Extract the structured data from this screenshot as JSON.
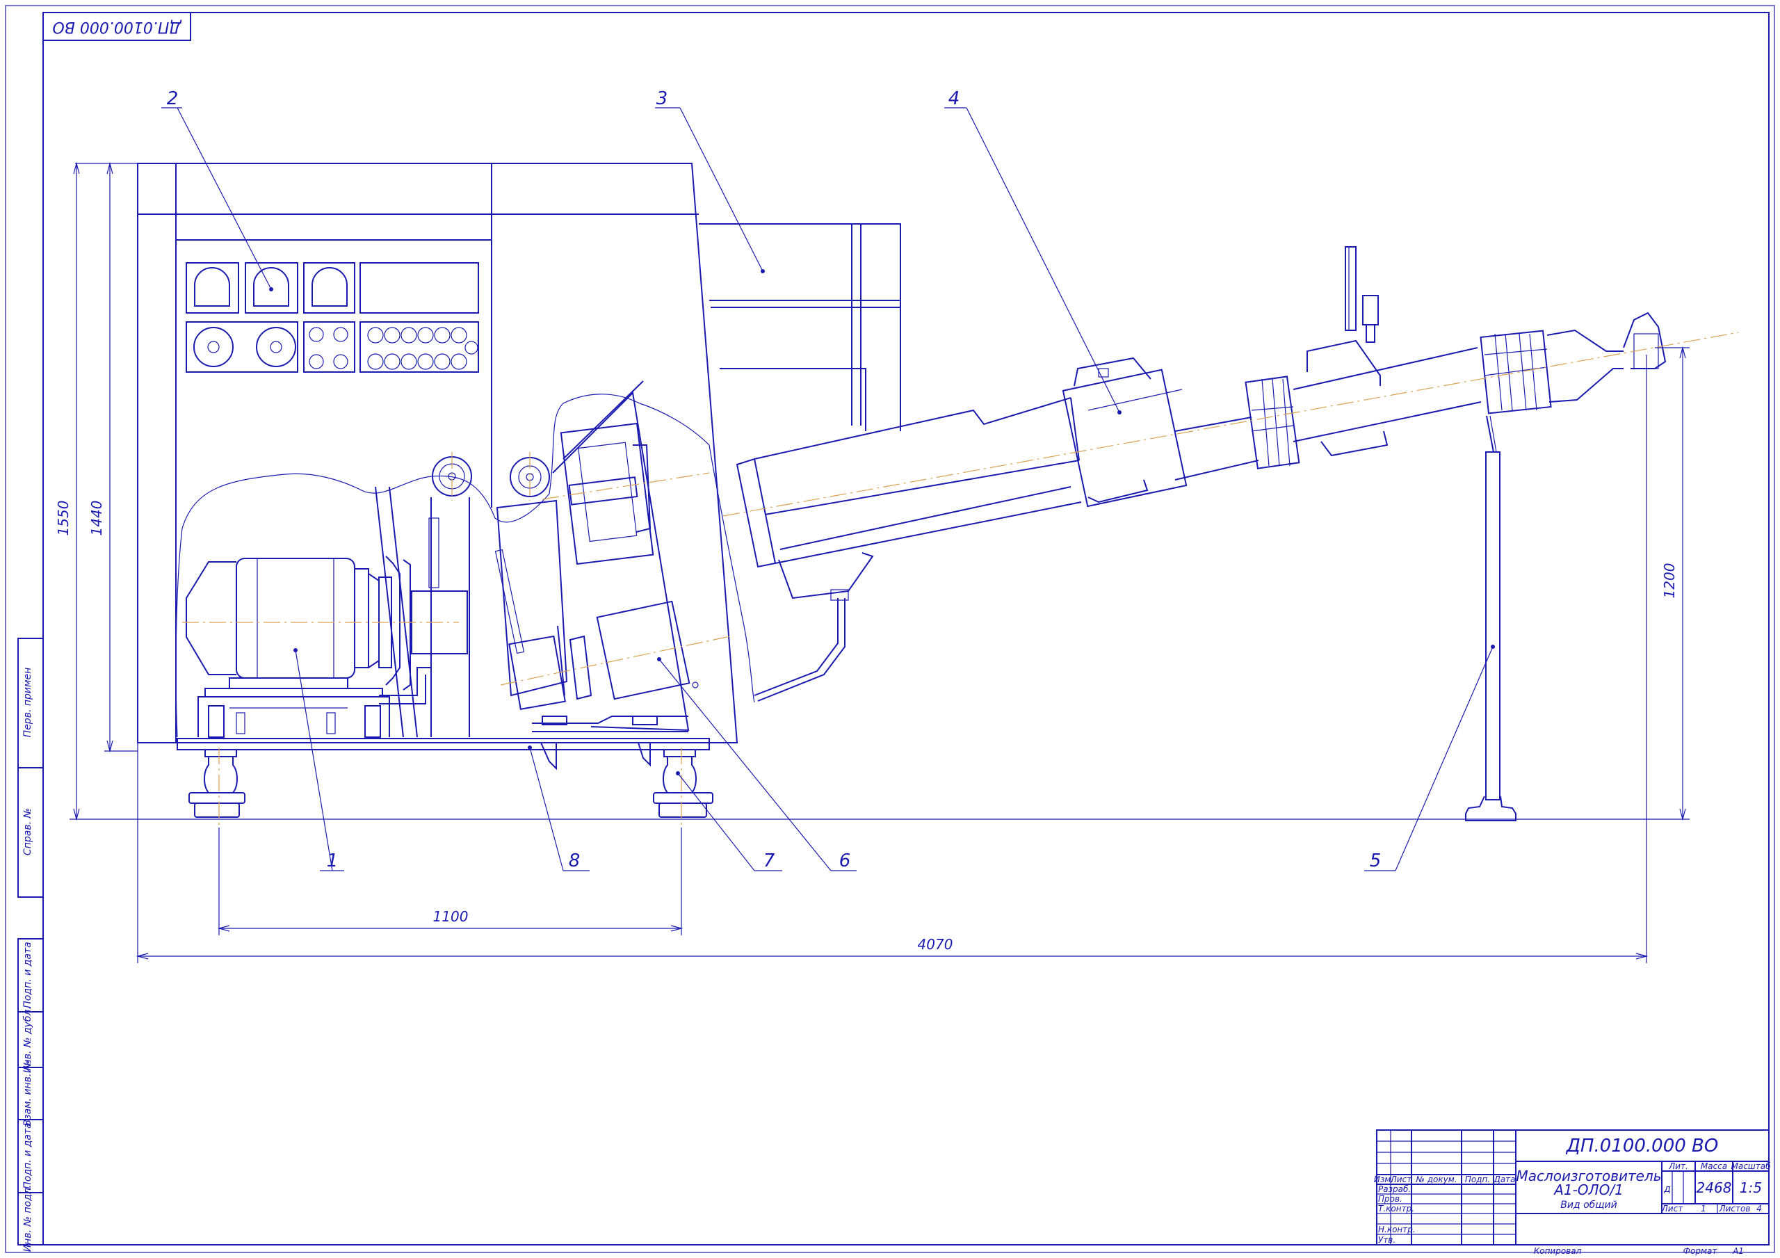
{
  "drawing": {
    "corner_code": "ДП.0100.000 ВО",
    "dimensions": {
      "height_overall": "1550",
      "height_body": "1440",
      "height_support": "1200",
      "span_feet": "1100",
      "length_overall": "4070"
    },
    "positions": [
      "1",
      "2",
      "3",
      "4",
      "5",
      "6",
      "7",
      "8"
    ],
    "side_strip": [
      "Перв. примен",
      "Справ. №",
      "Подп. и дата",
      "Инв. № дубл.",
      "Взам. инв. №",
      "Подп. и дата",
      "Инв. № подл."
    ]
  },
  "title_block": {
    "doc_code": "ДП.0100.000 ВО",
    "name_line1": "Маслоизготовитель",
    "name_line2": "А1-ОЛО/1",
    "view": "Вид общий",
    "col_lit": "Лит.",
    "col_mass": "Масса",
    "col_scale": "Масштаб",
    "lit_value": "д",
    "mass_value": "2468",
    "scale_value": "1:5",
    "sheet_label": "Лист",
    "sheet_value": "1",
    "sheets_label": "Листов",
    "sheets_value": "4",
    "hdr": [
      "Изм.",
      "Лист",
      "№ докум.",
      "Подп.",
      "Дата"
    ],
    "roles": [
      "Разраб.",
      "Пров.",
      "Т.контр.",
      "",
      "Н.контр.",
      "Утв."
    ],
    "copied": "Копировал",
    "format_label": "Формат",
    "format_value": "А1"
  }
}
